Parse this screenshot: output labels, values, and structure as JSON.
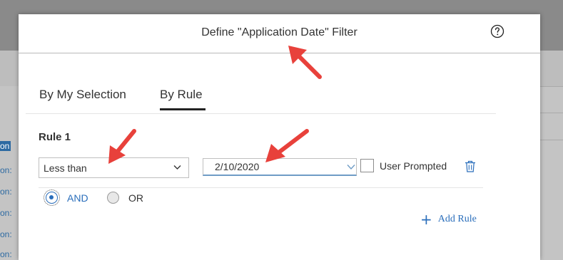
{
  "background": {
    "fragments": [
      "on",
      "on:",
      "on:",
      "on:",
      "on:",
      "on:"
    ]
  },
  "dialog": {
    "title": "Define \"Application Date\" Filter",
    "help_icon": "help-circle-icon"
  },
  "tabs": [
    {
      "label": "By My Selection",
      "active": false
    },
    {
      "label": "By Rule",
      "active": true
    }
  ],
  "rule": {
    "title": "Rule 1",
    "operator": {
      "selected": "Less than"
    },
    "date_value": "2/10/2020",
    "user_prompted_label": "User Prompted",
    "user_prompted_checked": false,
    "logic": [
      {
        "label": "AND",
        "selected": true
      },
      {
        "label": "OR",
        "selected": false
      }
    ],
    "delete_icon": "trash-icon"
  },
  "add_rule": {
    "label": "Add  Rule",
    "icon": "plus-icon"
  },
  "colors": {
    "accent": "#2a6ebb",
    "annotation_arrow": "#e8413b",
    "text": "#333333"
  }
}
